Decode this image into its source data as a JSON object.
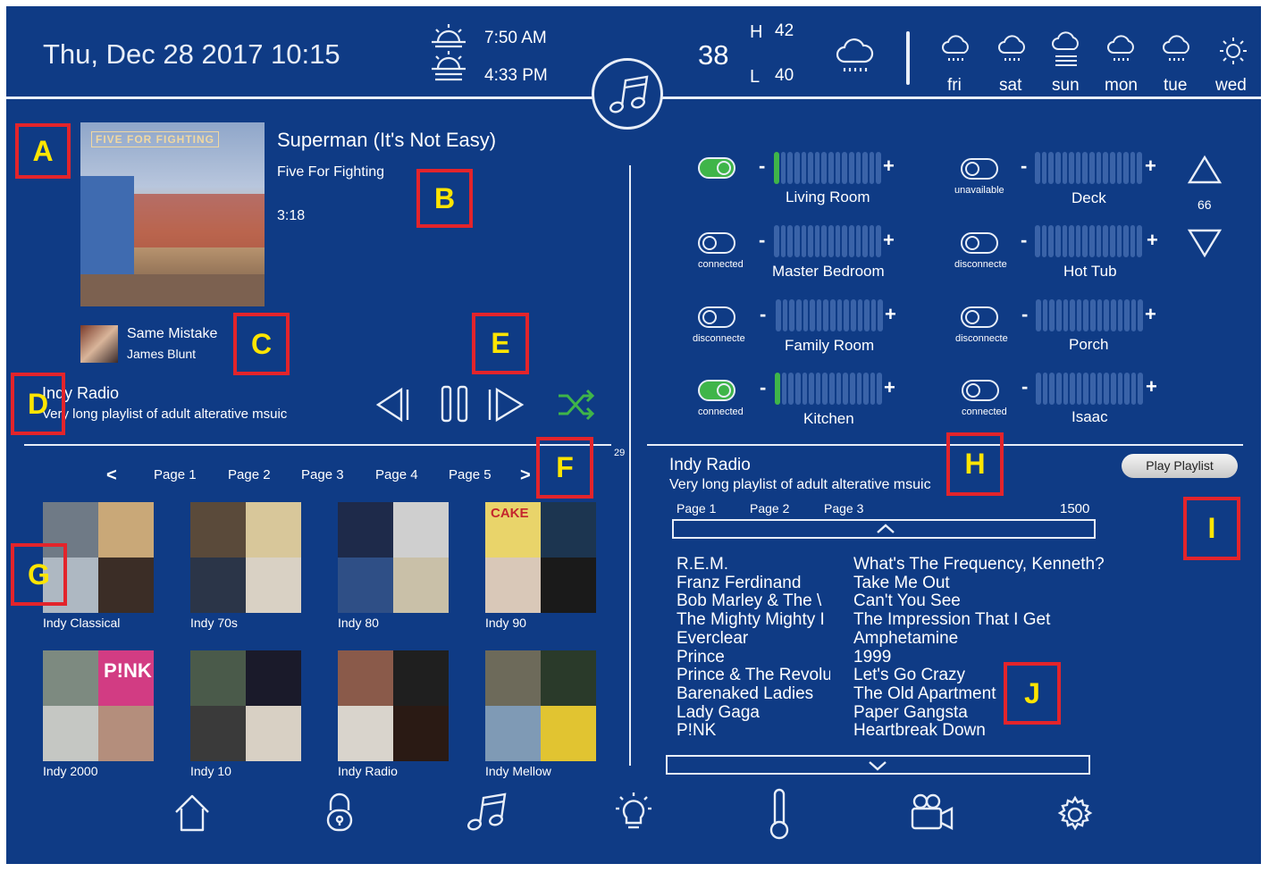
{
  "header": {
    "datetime": "Thu, Dec 28 2017 10:15",
    "sunrise": "7:50 AM",
    "sunset": "4:33 PM",
    "current_temp": "38",
    "high_label": "H",
    "high": "42",
    "low_label": "L",
    "low": "40",
    "forecast": [
      "fri",
      "sat",
      "sun",
      "mon",
      "tue",
      "wed"
    ]
  },
  "now_playing": {
    "album_art_text": "FIVE FOR FIGHTING",
    "title": "Superman (It's Not Easy)",
    "artist": "Five For Fighting",
    "duration": "3:18",
    "next_title": "Same Mistake",
    "next_artist": "James Blunt",
    "playlist_name": "Indy Radio",
    "playlist_desc": "Very long playlist of adult alterative msuic"
  },
  "zones": [
    {
      "name": "Living Room",
      "status": "",
      "on": true,
      "level": 0.05
    },
    {
      "name": "Deck",
      "status": "unavailable",
      "on": false,
      "level": 0
    },
    {
      "name": "Master Bedroom",
      "status": "connected",
      "on": false,
      "level": 0
    },
    {
      "name": "Hot Tub",
      "status": "disconnecte",
      "on": false,
      "level": 0
    },
    {
      "name": "Family Room",
      "status": "disconnecte",
      "on": false,
      "level": 0
    },
    {
      "name": "Porch",
      "status": "disconnecte",
      "on": false,
      "level": 0
    },
    {
      "name": "Kitchen",
      "status": "connected",
      "on": true,
      "level": 0.05
    },
    {
      "name": "Isaac",
      "status": "connected",
      "on": false,
      "level": 0
    }
  ],
  "zone_minus": "-",
  "zone_plus": "+",
  "volume": "66",
  "browser": {
    "prev": "<",
    "next": ">",
    "pages": [
      "Page 1",
      "Page 2",
      "Page 3",
      "Page 4",
      "Page 5"
    ],
    "count": "29",
    "playlists": [
      "Indy Classical",
      "Indy 70s",
      "Indy 80",
      "Indy 90",
      "Indy 2000",
      "Indy 10",
      "Indy Radio",
      "Indy Mellow"
    ],
    "tile_texts": [
      "CAKE",
      "P!NK"
    ]
  },
  "playlist_detail": {
    "name": "Indy Radio",
    "desc": "Very long playlist of adult alterative msuic",
    "play_button": "Play Playlist",
    "pages": [
      "Page 1",
      "Page 2",
      "Page 3"
    ],
    "total": "1500",
    "tracks": [
      {
        "artist": "R.E.M.",
        "title": "What's The Frequency, Kenneth?"
      },
      {
        "artist": "Franz Ferdinand",
        "title": "Take Me Out"
      },
      {
        "artist": "Bob Marley & The \\",
        "title": "Can't You See"
      },
      {
        "artist": "The Mighty Mighty I",
        "title": "The Impression That I Get"
      },
      {
        "artist": "Everclear",
        "title": "Amphetamine"
      },
      {
        "artist": "Prince",
        "title": "1999"
      },
      {
        "artist": "Prince & The Revolu",
        "title": "Let's Go Crazy"
      },
      {
        "artist": "Barenaked Ladies",
        "title": "The Old Apartment"
      },
      {
        "artist": "Lady Gaga",
        "title": "Paper Gangsta"
      },
      {
        "artist": "P!NK",
        "title": "Heartbreak Down"
      }
    ]
  },
  "markers": [
    "A",
    "B",
    "C",
    "D",
    "E",
    "F",
    "G",
    "H",
    "I",
    "J"
  ],
  "nav": [
    "home-icon",
    "lock-icon",
    "music-icon",
    "lightbulb-icon",
    "thermometer-icon",
    "camera-icon",
    "gear-icon"
  ],
  "colors": {
    "background": "#0f3b85",
    "accent_green": "#3fb549",
    "marker_red": "#e3242b",
    "marker_text": "#ffe500"
  }
}
